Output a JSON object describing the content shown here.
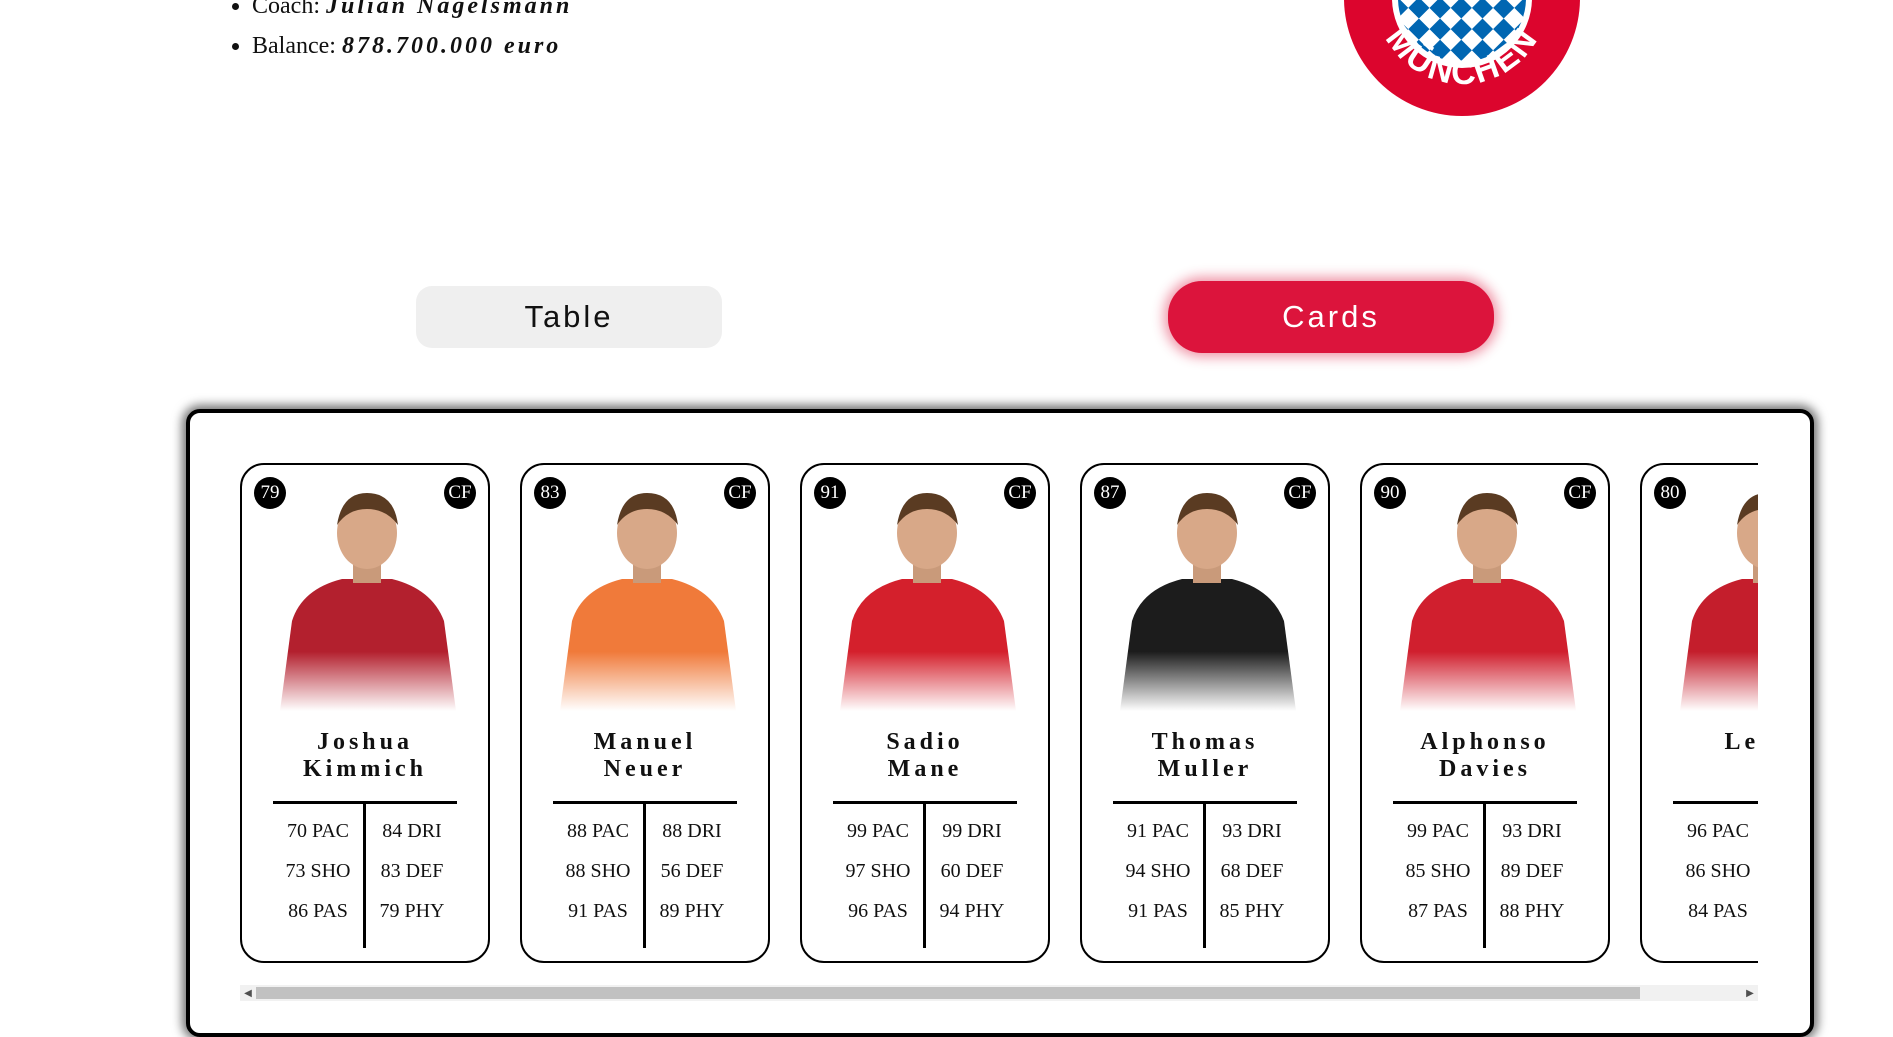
{
  "team": {
    "coach_label": "Coach:",
    "coach": "Julian Nagelsmann",
    "balance_label": "Balance:",
    "balance": "878.700.000 euro",
    "logo_text": "MÜNCHEN"
  },
  "views": {
    "table_label": "Table",
    "cards_label": "Cards",
    "active": "Cards"
  },
  "colors": {
    "accent": "#dc143c",
    "logo_red": "#dc052d",
    "logo_blue": "#0066b2"
  },
  "cards": [
    {
      "rating": "79",
      "position": "CF",
      "first": "Joshua",
      "last": "Kimmich",
      "pac": "70 PAC",
      "sho": "73 SHO",
      "pas": "86 PAS",
      "dri": "84 DRI",
      "def": "83 DEF",
      "phy": "79 PHY",
      "kit": "#b3202e"
    },
    {
      "rating": "83",
      "position": "CF",
      "first": "Manuel",
      "last": "Neuer",
      "pac": "88 PAC",
      "sho": "88 SHO",
      "pas": "91 PAS",
      "dri": "88 DRI",
      "def": "56 DEF",
      "phy": "89 PHY",
      "kit": "#f07a3a"
    },
    {
      "rating": "91",
      "position": "CF",
      "first": "Sadio",
      "last": "Mane",
      "pac": "99 PAC",
      "sho": "97 SHO",
      "pas": "96 PAS",
      "dri": "99 DRI",
      "def": "60 DEF",
      "phy": "94 PHY",
      "kit": "#d4202c"
    },
    {
      "rating": "87",
      "position": "CF",
      "first": "Thomas",
      "last": "Muller",
      "pac": "91 PAC",
      "sho": "94 SHO",
      "pas": "91 PAS",
      "dri": "93 DRI",
      "def": "68 DEF",
      "phy": "85 PHY",
      "kit": "#1c1c1c"
    },
    {
      "rating": "90",
      "position": "CF",
      "first": "Alphonso",
      "last": "Davies",
      "pac": "99 PAC",
      "sho": "85 SHO",
      "pas": "87 PAS",
      "dri": "93 DRI",
      "def": "89 DEF",
      "phy": "88 PHY",
      "kit": "#d01f2e"
    },
    {
      "rating": "80",
      "position": "",
      "first": "Leroy",
      "last": "",
      "pac": "96 PAC",
      "sho": "86 SHO",
      "pas": "84 PAS",
      "dri": "",
      "def": "",
      "phy": "",
      "kit": "#c41e2c"
    }
  ]
}
